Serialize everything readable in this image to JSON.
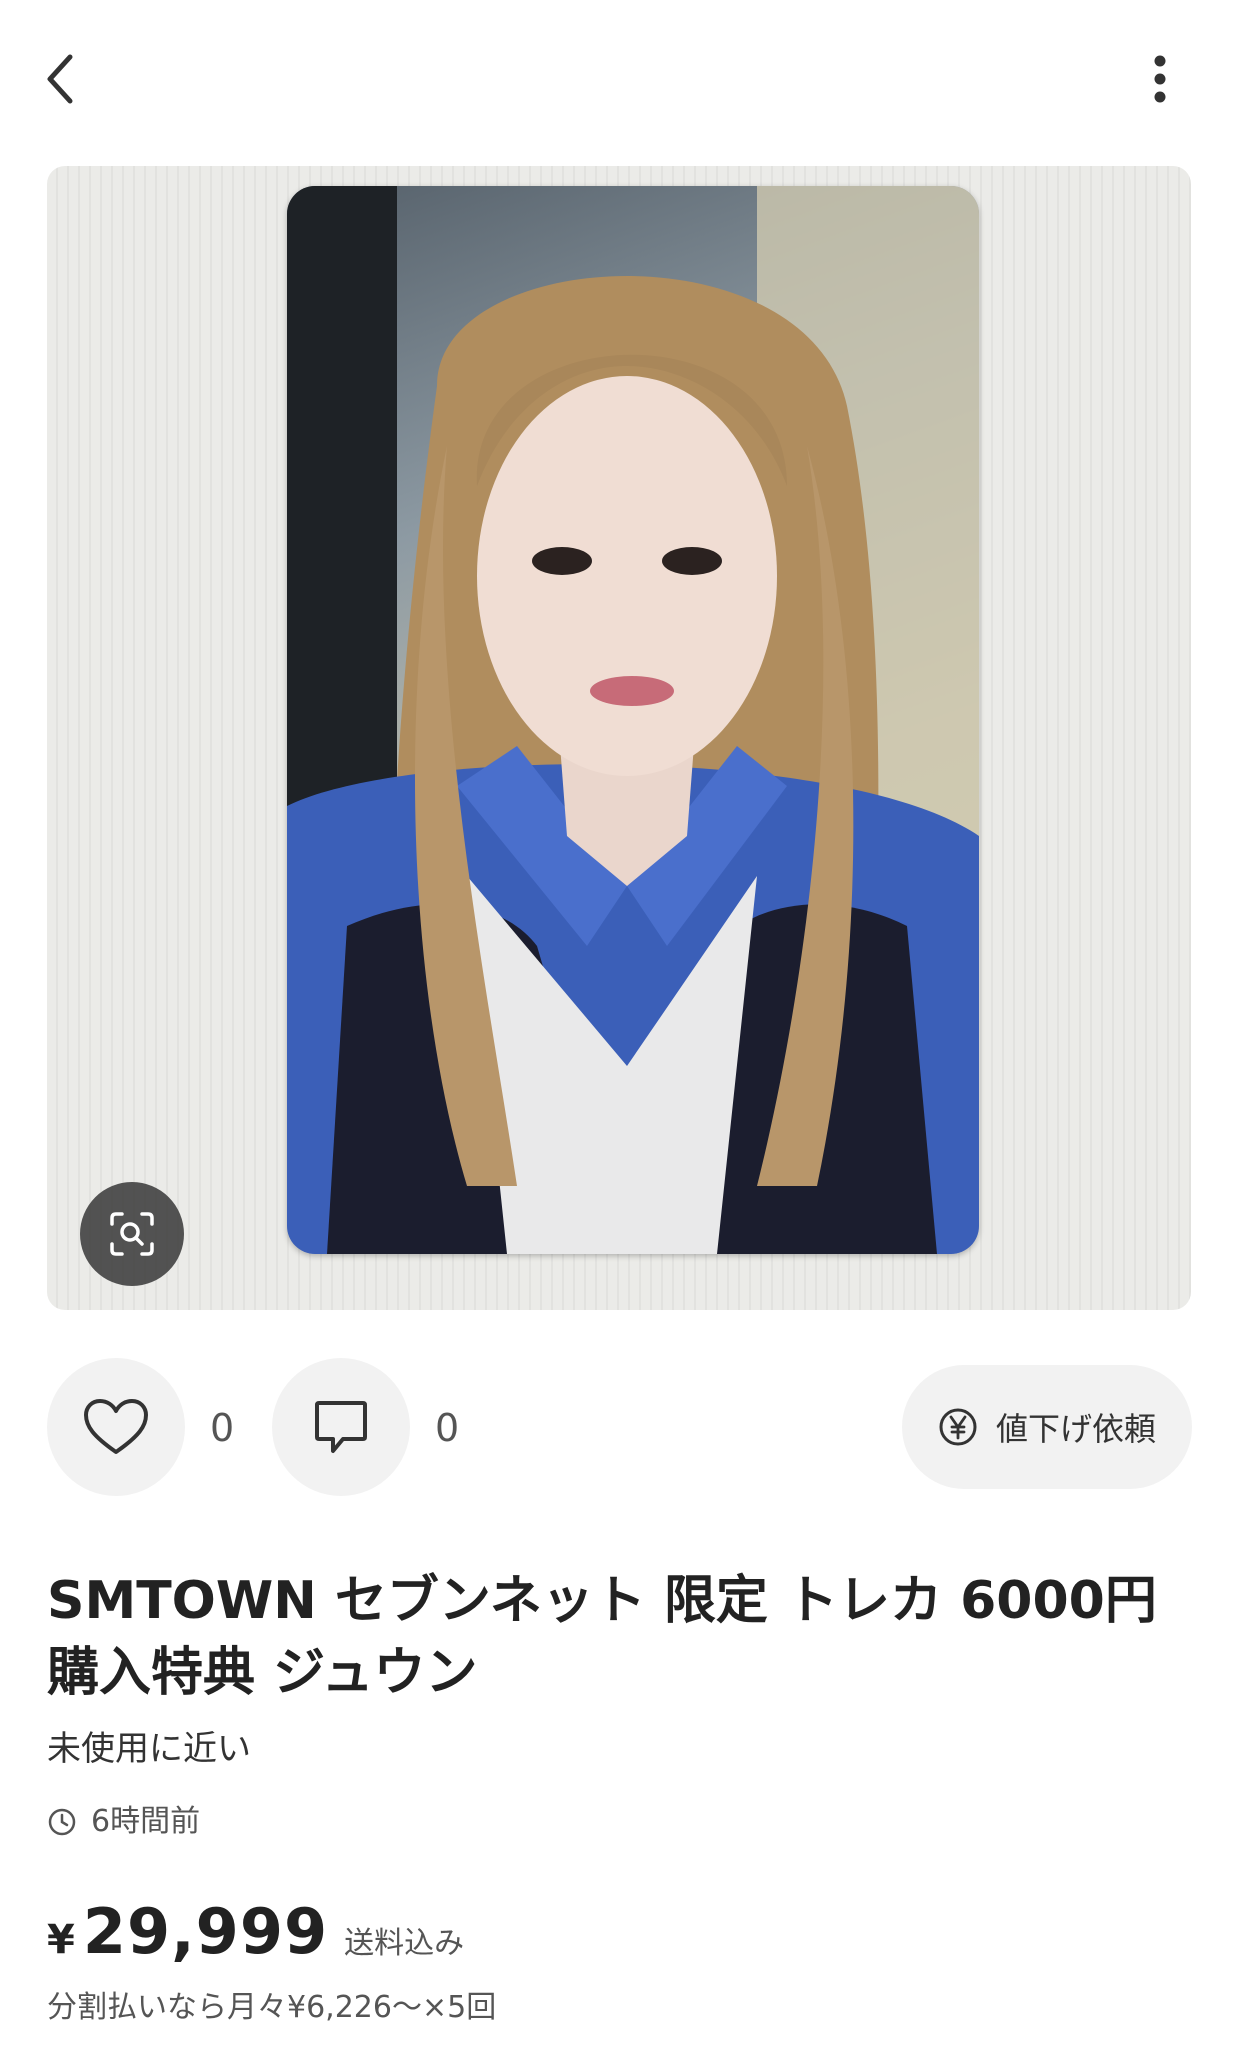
{
  "icons": {
    "back": "chevron-left-icon",
    "more": "more-vertical-icon",
    "lens": "image-search-icon",
    "like": "heart-icon",
    "comment": "comment-icon",
    "offer": "yen-circle-icon",
    "time": "clock-icon"
  },
  "actions": {
    "like_count": "0",
    "comment_count": "0",
    "offer_label": "値下げ依頼"
  },
  "item": {
    "title": "SMTOWN セブンネット 限定 トレカ 6000円 購入特典 ジュウン",
    "condition": "未使用に近い",
    "posted": "6時間前",
    "price_currency": "¥",
    "price_value": "29,999",
    "shipping": "送料込み",
    "installment": "分割払いなら月々¥6,226〜×5回"
  },
  "colors": {
    "button_bg": "#f2f2f2",
    "text_primary": "#222222",
    "text_secondary": "#555555"
  }
}
